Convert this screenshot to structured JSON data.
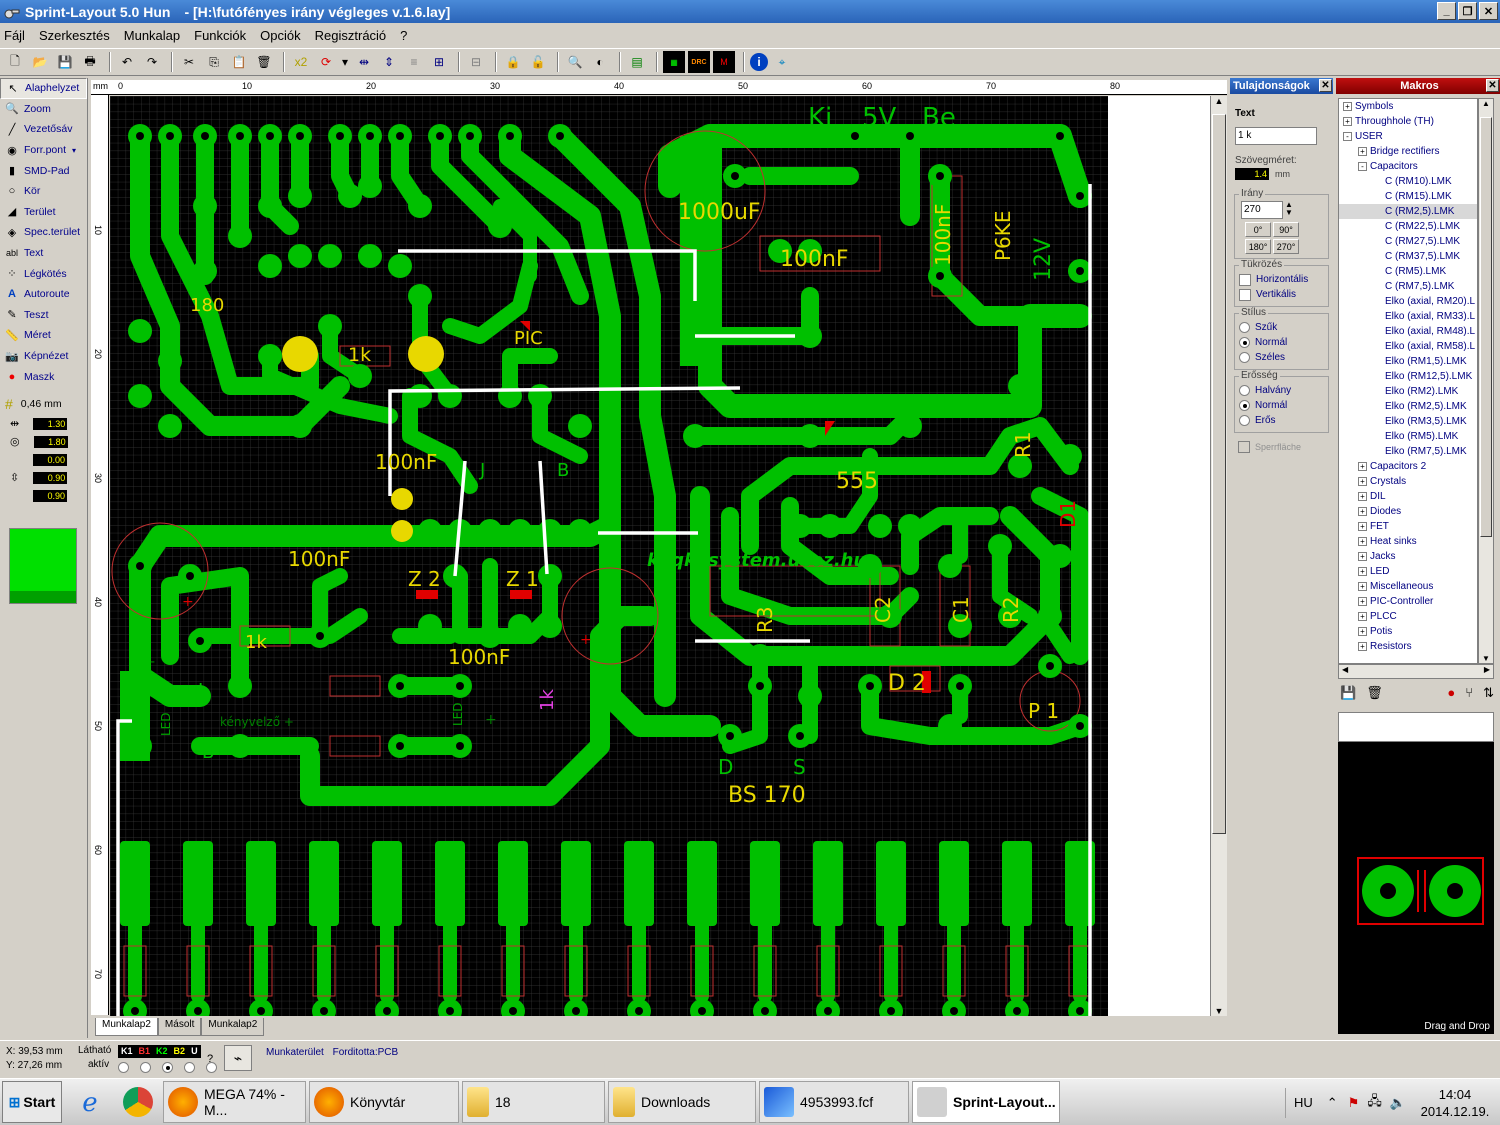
{
  "window": {
    "app_title": "Sprint-Layout 5.0 Hun",
    "file_title": "- [H:\\futófényes irány végleges v.1.6.lay]"
  },
  "menu": [
    "Fájl",
    "Szerkesztés",
    "Munkalap",
    "Funkciók",
    "Opciók",
    "Regisztráció",
    "?"
  ],
  "tools": [
    {
      "label": "Alaphelyzet",
      "icon": "pointer-icon"
    },
    {
      "label": "Zoom",
      "icon": "zoom-icon"
    },
    {
      "label": "Vezetősáv",
      "icon": "track-icon"
    },
    {
      "label": "Forr.pont",
      "icon": "pad-icon"
    },
    {
      "label": "SMD-Pad",
      "icon": "smd-pad-icon"
    },
    {
      "label": "Kör",
      "icon": "circle-icon"
    },
    {
      "label": "Terület",
      "icon": "area-icon"
    },
    {
      "label": "Spec.terület",
      "icon": "special-area-icon"
    },
    {
      "label": "Text",
      "icon": "text-icon"
    },
    {
      "label": "Légkötés",
      "icon": "airwire-icon"
    },
    {
      "label": "Autoroute",
      "icon": "autoroute-icon"
    },
    {
      "label": "Teszt",
      "icon": "test-icon"
    },
    {
      "label": "Méret",
      "icon": "measure-icon"
    },
    {
      "label": "Képnézet",
      "icon": "photoview-icon"
    },
    {
      "label": "Maszk",
      "icon": "mask-icon"
    }
  ],
  "grid": "0,46 mm",
  "values": [
    "1.30",
    "1.80",
    "0.00",
    "0.90",
    "0.90"
  ],
  "ruler": {
    "unit": "mm",
    "top": [
      "0",
      "10",
      "20",
      "30",
      "40",
      "50",
      "60",
      "70",
      "80"
    ],
    "left": [
      "10",
      "20",
      "30",
      "40",
      "50",
      "60",
      "70"
    ]
  },
  "sheet_tabs": [
    "Munkalap2",
    "Másolt",
    "Munkalap2"
  ],
  "pcb": {
    "watermark": "kaqkksystem.ucoz.hu",
    "labels": [
      "Ki",
      "5V",
      "Be",
      "1000uF",
      "100nF",
      "100nF",
      "P6KE",
      "12V",
      "180",
      "1k",
      "PIC",
      "100nF",
      "J",
      "B",
      "R1",
      "555",
      "D1",
      "100nF",
      "Z 2",
      "Z 1",
      "R3",
      "C2",
      "C1",
      "R2",
      "1k",
      "100nF",
      "1k",
      "D 2",
      "P 1",
      "D",
      "S",
      "BS 170",
      "J",
      "B",
      "LED",
      "LED",
      "kényvelző +",
      "+",
      "+",
      "-",
      "+"
    ]
  },
  "properties": {
    "title": "Tulajdonságok",
    "text_label": "Text",
    "text_value": "1 k",
    "size_label": "Szövegméret:",
    "size_value": "1.4",
    "size_unit": "mm",
    "direction_label": "Irány",
    "direction_value": "270",
    "angles": [
      "0°",
      "90°",
      "180°",
      "270°"
    ],
    "mirror_label": "Tükrözés",
    "mirror_h": "Horizontális",
    "mirror_v": "Vertikális",
    "style_label": "Stílus",
    "style_opts": [
      "Szűk",
      "Normál",
      "Széles"
    ],
    "strength_label": "Erősség",
    "strength_opts": [
      "Halvány",
      "Normál",
      "Erős"
    ],
    "sperr_label": "Sperrfläche"
  },
  "macros": {
    "title": "Makros",
    "tree": [
      {
        "label": "Symbols",
        "level": 0,
        "pm": "+"
      },
      {
        "label": "Throughhole (TH)",
        "level": 0,
        "pm": "+"
      },
      {
        "label": "USER",
        "level": 0,
        "pm": "-"
      },
      {
        "label": "Bridge rectifiers",
        "level": 1,
        "pm": "+"
      },
      {
        "label": "Capacitors",
        "level": 1,
        "pm": "-"
      },
      {
        "label": "C (RM10).LMK",
        "level": 2,
        "pm": ""
      },
      {
        "label": "C (RM15).LMK",
        "level": 2,
        "pm": ""
      },
      {
        "label": "C (RM2,5).LMK",
        "level": 2,
        "pm": "",
        "selected": true
      },
      {
        "label": "C (RM22,5).LMK",
        "level": 2,
        "pm": ""
      },
      {
        "label": "C (RM27,5).LMK",
        "level": 2,
        "pm": ""
      },
      {
        "label": "C (RM37,5).LMK",
        "level": 2,
        "pm": ""
      },
      {
        "label": "C (RM5).LMK",
        "level": 2,
        "pm": ""
      },
      {
        "label": "C (RM7,5).LMK",
        "level": 2,
        "pm": ""
      },
      {
        "label": "Elko (axial, RM20).L",
        "level": 2,
        "pm": ""
      },
      {
        "label": "Elko (axial, RM33).L",
        "level": 2,
        "pm": ""
      },
      {
        "label": "Elko (axial, RM48).L",
        "level": 2,
        "pm": ""
      },
      {
        "label": "Elko (axial, RM58).L",
        "level": 2,
        "pm": ""
      },
      {
        "label": "Elko (RM1,5).LMK",
        "level": 2,
        "pm": ""
      },
      {
        "label": "Elko (RM12,5).LMK",
        "level": 2,
        "pm": ""
      },
      {
        "label": "Elko (RM2).LMK",
        "level": 2,
        "pm": ""
      },
      {
        "label": "Elko (RM2,5).LMK",
        "level": 2,
        "pm": ""
      },
      {
        "label": "Elko (RM3,5).LMK",
        "level": 2,
        "pm": ""
      },
      {
        "label": "Elko (RM5).LMK",
        "level": 2,
        "pm": ""
      },
      {
        "label": "Elko (RM7,5).LMK",
        "level": 2,
        "pm": ""
      },
      {
        "label": "Capacitors 2",
        "level": 1,
        "pm": "+"
      },
      {
        "label": "Crystals",
        "level": 1,
        "pm": "+"
      },
      {
        "label": "DIL",
        "level": 1,
        "pm": "+"
      },
      {
        "label": "Diodes",
        "level": 1,
        "pm": "+"
      },
      {
        "label": "FET",
        "level": 1,
        "pm": "+"
      },
      {
        "label": "Heat sinks",
        "level": 1,
        "pm": "+"
      },
      {
        "label": "Jacks",
        "level": 1,
        "pm": "+"
      },
      {
        "label": "LED",
        "level": 1,
        "pm": "+"
      },
      {
        "label": "Miscellaneous",
        "level": 1,
        "pm": "+"
      },
      {
        "label": "PIC-Controller",
        "level": 1,
        "pm": "+"
      },
      {
        "label": "PLCC",
        "level": 1,
        "pm": "+"
      },
      {
        "label": "Potis",
        "level": 1,
        "pm": "+"
      },
      {
        "label": "Resistors",
        "level": 1,
        "pm": "+"
      }
    ],
    "drag_drop": "Drag and Drop"
  },
  "status": {
    "x": "X:   39,53 mm",
    "y": "Y:   27,26 mm",
    "visible_label": "Látható",
    "active_label": "aktív",
    "layers": [
      "K1",
      "B1",
      "K2",
      "B2",
      "U"
    ],
    "layer_colors": [
      "#ffffff",
      "#ff3030",
      "#00ff00",
      "#ffff00",
      "#ffffff"
    ],
    "question": "?",
    "info1": "Munkaterület",
    "info2": "Forditotta:PCB"
  },
  "taskbar": {
    "start": "Start",
    "tasks": [
      {
        "label": "MEGA 74% - M...",
        "icon": "firefox-icon"
      },
      {
        "label": "Könyvtár",
        "icon": "firefox-icon"
      },
      {
        "label": "18",
        "icon": "folder-icon"
      },
      {
        "label": "Downloads",
        "icon": "folder-icon"
      },
      {
        "label": "4953993.fcf",
        "icon": "app-icon"
      },
      {
        "label": "Sprint-Layout...",
        "icon": "sprint-icon",
        "active": true
      }
    ],
    "lang": "HU",
    "time": "14:04",
    "date": "2014.12.19."
  }
}
